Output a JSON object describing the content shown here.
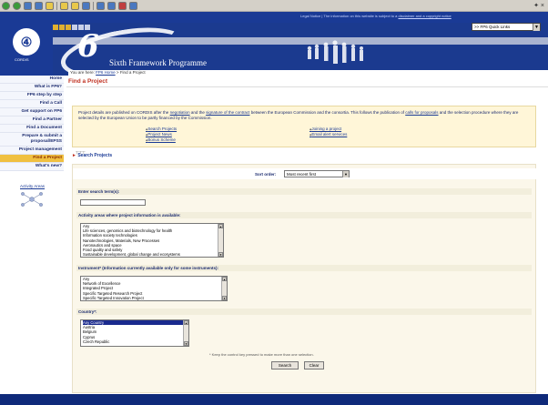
{
  "window": {
    "toolbar_label": "✦ ×"
  },
  "banner": {
    "legal_notice": "Legal Notice | The information on this website is subject to a",
    "legal_link": "disclaimer and a copyright notice",
    "quicklinks": ">> FP6 Quick Links",
    "cordis_logo": "④",
    "cordis_text": "CORDIS",
    "programme_title": "Sixth Framework Programme",
    "programme_six": "6"
  },
  "breadcrumb": {
    "prefix": "You are here:",
    "home": "FP6 Home",
    "sep": ">",
    "current": "Find a Project"
  },
  "sidebar": {
    "items": [
      {
        "label": "Home",
        "active": false
      },
      {
        "label": "What is FP6?",
        "active": false
      },
      {
        "label": "FP6 step by step",
        "active": false
      },
      {
        "label": "Find a Call",
        "active": false
      },
      {
        "label": "Get support on FP6",
        "active": false
      },
      {
        "label": "Find a Partner",
        "active": false
      },
      {
        "label": "Find a Document",
        "active": false
      },
      {
        "label": "Prepare & submit a proposal/EPSS",
        "active": false
      },
      {
        "label": "Project management",
        "active": false
      },
      {
        "label": "Find a Project",
        "active": true
      },
      {
        "label": "What's new?",
        "active": false
      }
    ],
    "activity_areas": "Activity Areas"
  },
  "main": {
    "title": "Find a Project",
    "intro_part1": "Project details are published on CORDIS after the",
    "intro_link1": "negotiation",
    "intro_part2": "and the",
    "intro_link2": "signature of the contract",
    "intro_part3": "between the European Commission and the consortia. This follows the publication of",
    "intro_link3": "calls for proposals",
    "intro_part4": "and the selection procedure where they are selected by the European Union to be partly financed by the Commission.",
    "links_left": [
      "Search Projects",
      "Project News",
      "Bonus Scheme"
    ],
    "links_right": [
      "Joining a project",
      "Email alert services"
    ],
    "search_projects": "Search Projects",
    "sort_label": "Sort order:",
    "sort_value": "Most recent first",
    "search_terms_label": "Enter search term(s):",
    "search_terms_value": "",
    "activity_label": "Activity areas where project information is available:",
    "activity_options": [
      "Any",
      "Life sciences, genomics and biotechnology for health",
      "Information society technologies",
      "Nanotechnologies, Materials, New Processes",
      "Aeronautics and space",
      "Food quality and safety",
      "Sustainable development, global change and ecosystems"
    ],
    "instrument_label": "Instrument* (Information currently available only for some instruments):",
    "instrument_options": [
      "Any",
      "Network of Excellence",
      "Integrated Project",
      "Specific Targeted Research Project",
      "Specific Targeted Innovation Project"
    ],
    "country_label": "Country*:",
    "country_options": [
      "Any Country",
      "Austria",
      "Belgium",
      "Cyprus",
      "Czech Republic"
    ],
    "note": "* Keep the control key pressed to make more than one selection.",
    "search_button": "Search",
    "clear_button": "Clear"
  }
}
